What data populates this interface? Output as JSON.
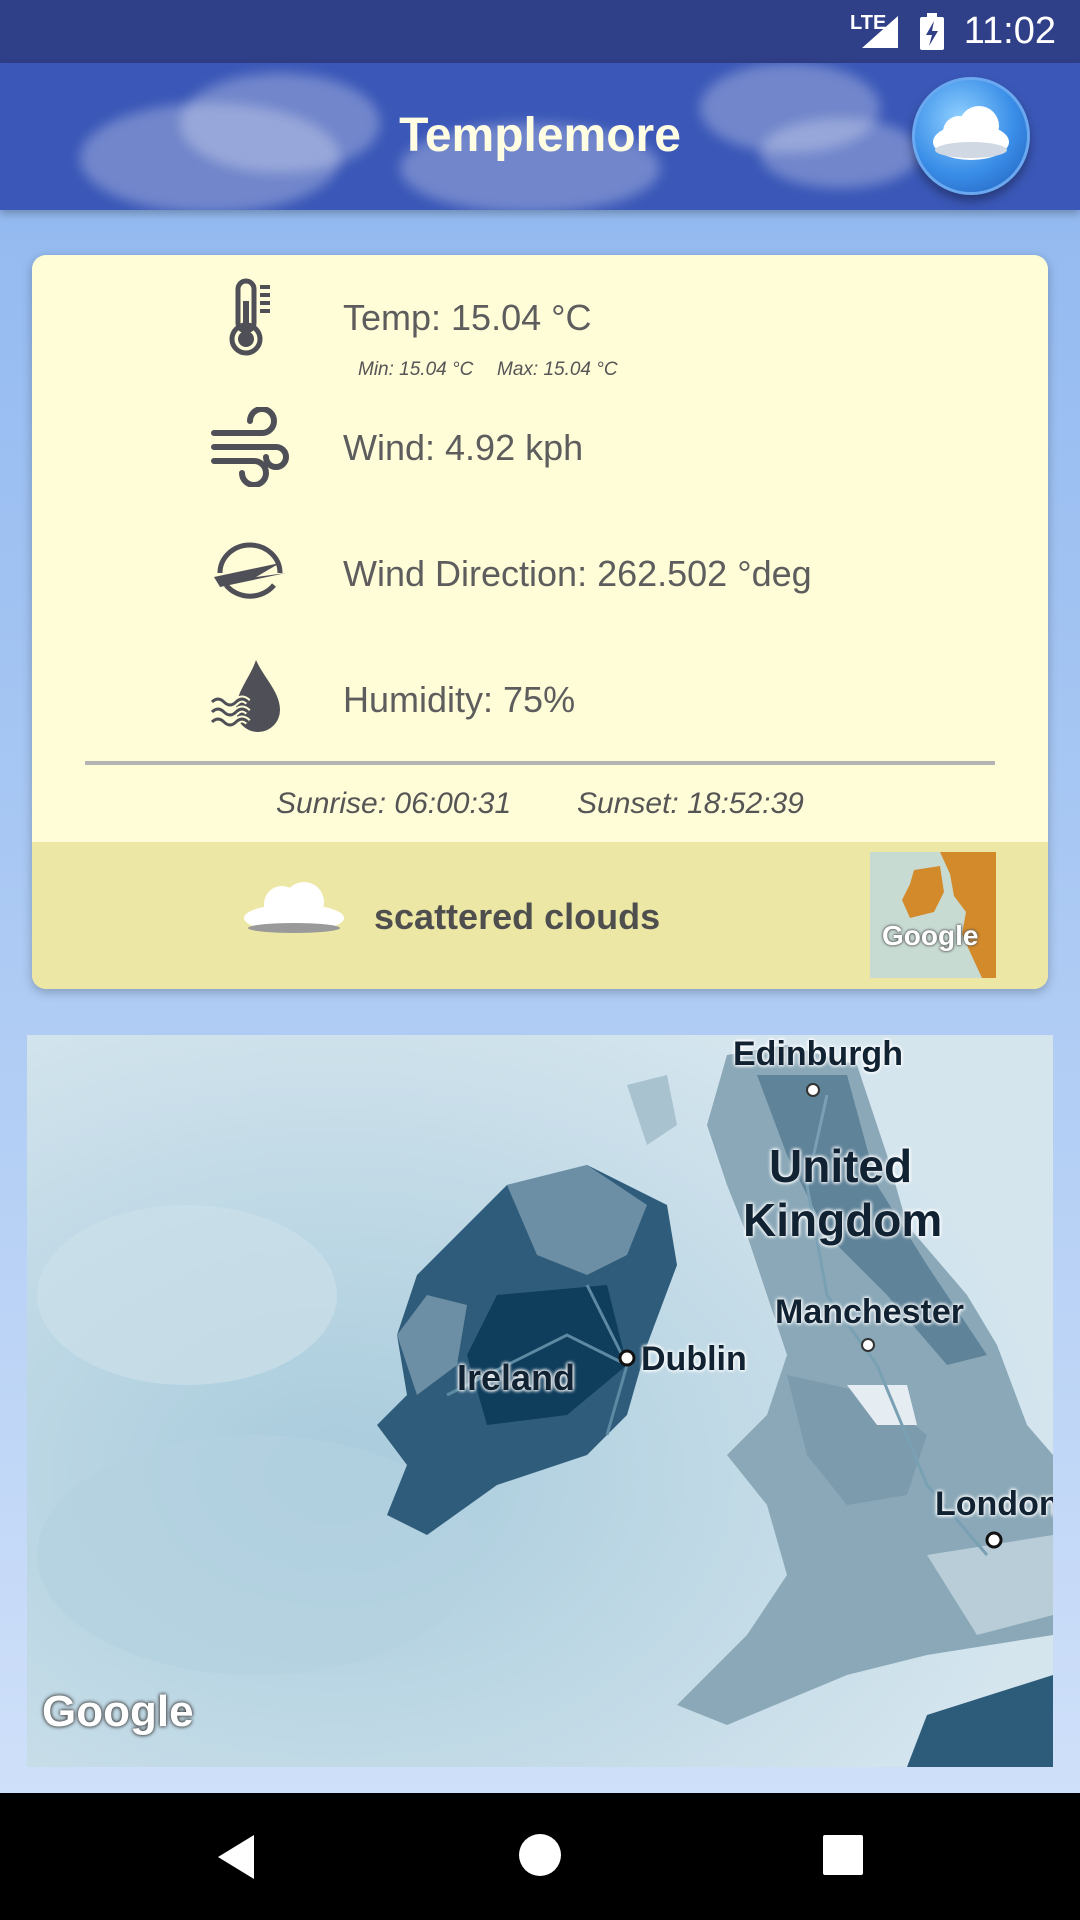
{
  "status_bar": {
    "network": "LTE",
    "time": "11:02"
  },
  "app_bar": {
    "title": "Templemore",
    "action_icon": "cloud-icon"
  },
  "weather": {
    "temp": "Temp: 15.04 °C",
    "min": "Min: 15.04 °C",
    "max": "Max: 15.04 °C",
    "wind": "Wind: 4.92 kph",
    "wind_direction": "Wind Direction: 262.502 °deg",
    "humidity": "Humidity: 75%",
    "sunrise": "Sunrise: 06:00:31",
    "sunset": "Sunset: 18:52:39",
    "description": "scattered clouds",
    "thumbnail_label": "Google"
  },
  "map": {
    "labels": {
      "edinburgh": "Edinburgh",
      "uk_line1": "United",
      "uk_line2": "Kingdom",
      "manchester": "Manchester",
      "ireland": "Ireland",
      "dublin": "Dublin",
      "london": "London"
    },
    "attribution": "Google"
  },
  "nav": {
    "back": "back-icon",
    "home": "home-icon",
    "recents": "recents-icon"
  },
  "colors": {
    "status_bar": "#2f3f88",
    "app_bar": "#3b58b8",
    "card": "#fffcd8",
    "card_footer": "#ede7a5",
    "title_text": "#fffde2"
  }
}
